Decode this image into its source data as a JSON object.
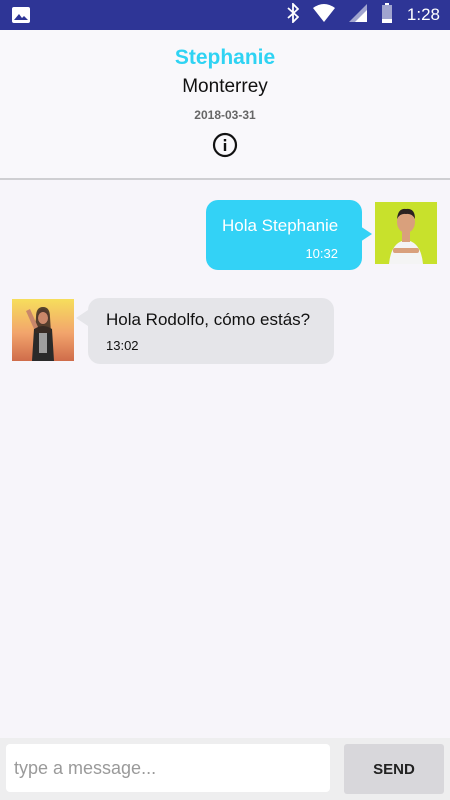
{
  "status_bar": {
    "time": "1:28",
    "icons": [
      "gallery-icon",
      "bluetooth-icon",
      "wifi-icon",
      "signal-icon",
      "battery-icon"
    ]
  },
  "header": {
    "contact_name": "Stephanie",
    "location": "Monterrey",
    "date": "2018-03-31",
    "info_icon": "info-icon"
  },
  "messages": [
    {
      "direction": "outgoing",
      "text": "Hola Stephanie",
      "time": "10:32"
    },
    {
      "direction": "incoming",
      "text": "Hola Rodolfo, cómo estás?",
      "time": "13:02"
    }
  ],
  "composer": {
    "placeholder": "type a message...",
    "value": "",
    "send_label": "SEND"
  },
  "colors": {
    "status_bar": "#2e3596",
    "accent": "#2fd3f3",
    "outgoing_bubble": "#33d2f6",
    "incoming_bubble": "#e5e5e9"
  }
}
